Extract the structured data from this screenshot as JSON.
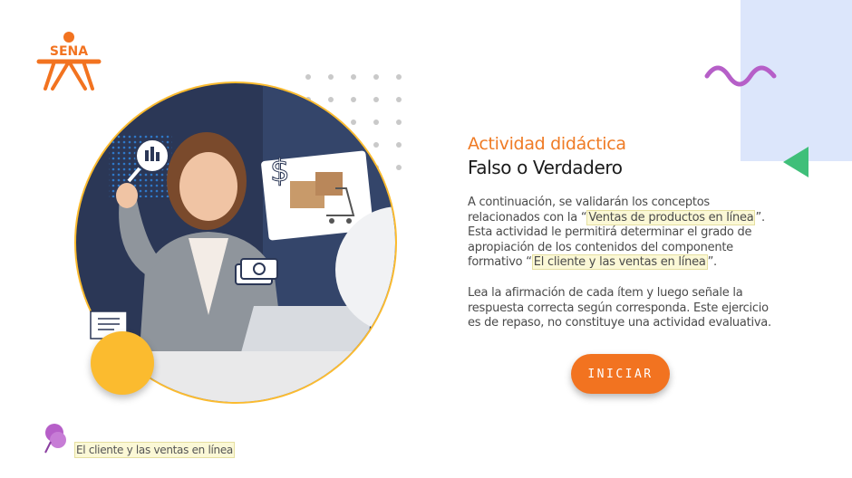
{
  "brand": {
    "logo_text": "SENA"
  },
  "header": {
    "kicker": "Actividad didáctica",
    "title": "Falso o Verdadero"
  },
  "intro": {
    "p1_a": "A continuación, se validarán los conceptos relacionados con la “",
    "p1_highlight": "Ventas de productos en línea",
    "p1_b": "”. Esta actividad le permitirá determinar el grado de apropiación de los contenidos del componente formativo “",
    "p1_highlight2": "El cliente y las ventas en línea",
    "p1_c": "”.",
    "p2": "Lea la afirmación de cada ítem y luego señale la respuesta correcta según corresponda.  Este ejercicio es de repaso, no constituye una actividad evaluativa."
  },
  "actions": {
    "start_label": "INICIAR"
  },
  "footer": {
    "course_label": "El cliente y las ventas en línea"
  },
  "colors": {
    "accent_orange": "#f27320",
    "kicker_orange": "#ef7b25",
    "yellow": "#fbbb2f",
    "navy": "#2b3756",
    "purple": "#b65fc8",
    "green": "#3fbf79",
    "light_blue": "#dce6fb"
  },
  "icons": {
    "logo": "sena-logo",
    "wave": "wave-decoration-icon",
    "triangle": "triangle-decoration-icon",
    "pin": "pushpin-icon",
    "dollar": "dollar-icon",
    "money": "banknotes-icon",
    "cart": "shopping-cart-icon",
    "chart": "chart-search-icon"
  }
}
